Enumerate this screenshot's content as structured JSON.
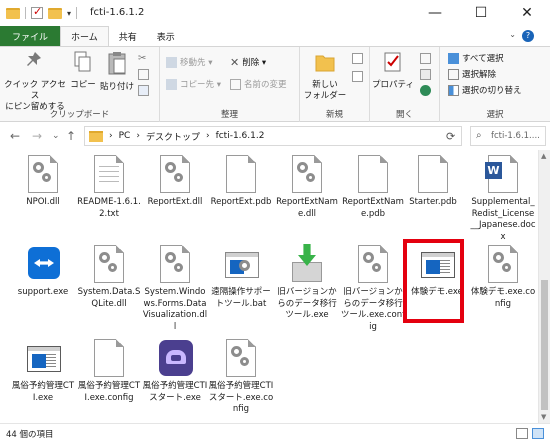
{
  "window": {
    "title": "fcti-1.6.1.2",
    "minimize": "—",
    "maximize": "☐",
    "close": "✕"
  },
  "ribbon_tabs": [
    "ファイル",
    "ホーム",
    "共有",
    "表示"
  ],
  "ribbon": {
    "clipboard": {
      "label": "クリップボード",
      "pin": "クイック アクセス\nにピン留めする",
      "copy": "コピー",
      "paste": "貼り付け"
    },
    "organize": {
      "label": "整理",
      "move_to": "移動先 ▾",
      "copy_to": "コピー先 ▾",
      "delete": "削除 ▾",
      "rename": "名前の変更"
    },
    "new": {
      "label": "新規",
      "new_folder": "新しい\nフォルダー"
    },
    "open": {
      "label": "開く",
      "properties": "プロパティ"
    },
    "select": {
      "label": "選択",
      "select_all": "すべて選択",
      "select_none": "選択解除",
      "invert": "選択の切り替え"
    }
  },
  "address": {
    "back": "←",
    "forward": "→",
    "recent": "⌄",
    "up": "↑",
    "crumbs": [
      "PC",
      "デスクトップ",
      "fcti-1.6.1.2"
    ],
    "sep": "›",
    "search_placeholder": "fcti-1.6.1...."
  },
  "files": [
    {
      "name": "NPOI.dll",
      "icon": "dll-gear"
    },
    {
      "name": "README-1.6.1.2.txt",
      "icon": "text-doc"
    },
    {
      "name": "ReportExt.dll",
      "icon": "dll-gear"
    },
    {
      "name": "ReportExt.pdb",
      "icon": "blank-doc"
    },
    {
      "name": "ReportExtName.dll",
      "icon": "dll-gear"
    },
    {
      "name": "ReportExtName.pdb",
      "icon": "blank-doc"
    },
    {
      "name": "Starter.pdb",
      "icon": "blank-doc"
    },
    {
      "name": "Supplemental_Redist_License__Japanese.docx",
      "icon": "word-doc"
    },
    {
      "name": "support.exe",
      "icon": "teamviewer-exe"
    },
    {
      "name": "System.Data.SQLite.dll",
      "icon": "dll-gear"
    },
    {
      "name": "System.Windows.Forms.DataVisualization.dll",
      "icon": "dll-gear"
    },
    {
      "name": "遠隔操作サポートツール.bat",
      "icon": "bat-gear"
    },
    {
      "name": "旧バージョンからのデータ移行ツール.exe",
      "icon": "installer-exe"
    },
    {
      "name": "旧バージョンからのデータ移行ツール.exe.config",
      "icon": "config-gear"
    },
    {
      "name": "体験デモ.exe",
      "icon": "app-window-exe"
    },
    {
      "name": "体験デモ.exe.config",
      "icon": "config-gear"
    },
    {
      "name": "風俗予約管理CTI.exe",
      "icon": "app-window-exe"
    },
    {
      "name": "風俗予約管理CTI.exe.config",
      "icon": "blank-doc"
    },
    {
      "name": "風俗予約管理CTIスタート.exe",
      "icon": "phone-exe"
    },
    {
      "name": "風俗予約管理CTIスタート.exe.config",
      "icon": "config-gear"
    }
  ],
  "status": {
    "item_count": "44 個の項目"
  },
  "colors": {
    "file_tab": "#2b7a32",
    "highlight": "#e4000f",
    "accent_blue": "#1565c0"
  }
}
